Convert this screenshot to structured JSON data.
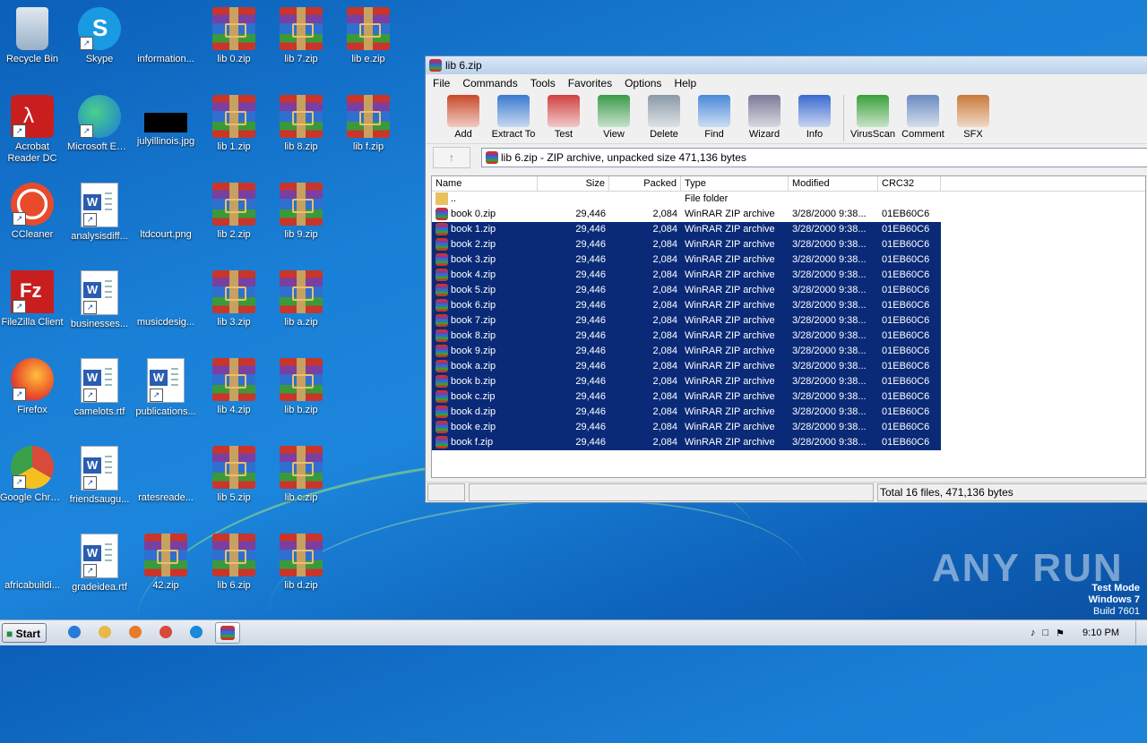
{
  "desktop": {
    "icons": [
      {
        "label": "Recycle Bin",
        "type": "recyclebin"
      },
      {
        "label": "Skype",
        "type": "skype"
      },
      {
        "label": "information...",
        "type": "blank"
      },
      {
        "label": "lib 0.zip",
        "type": "rar"
      },
      {
        "label": "lib 7.zip",
        "type": "rar"
      },
      {
        "label": "lib e.zip",
        "type": "rar"
      },
      {
        "label": "Acrobat Reader DC",
        "type": "acrobat"
      },
      {
        "label": "Microsoft Edge",
        "type": "edge"
      },
      {
        "label": "julyillinois.jpg",
        "type": "jpg"
      },
      {
        "label": "lib 1.zip",
        "type": "rar"
      },
      {
        "label": "lib 8.zip",
        "type": "rar"
      },
      {
        "label": "lib f.zip",
        "type": "rar"
      },
      {
        "label": "CCleaner",
        "type": "ccleaner"
      },
      {
        "label": "analysisdiff...",
        "type": "doc"
      },
      {
        "label": "ltdcourt.png",
        "type": "blank"
      },
      {
        "label": "lib 2.zip",
        "type": "rar"
      },
      {
        "label": "lib 9.zip",
        "type": "rar"
      },
      {
        "label": "FileZilla Client",
        "type": "filezilla"
      },
      {
        "label": "businesses...",
        "type": "doc"
      },
      {
        "label": "musicdesig...",
        "type": "blank"
      },
      {
        "label": "lib 3.zip",
        "type": "rar"
      },
      {
        "label": "lib a.zip",
        "type": "rar"
      },
      {
        "label": "Firefox",
        "type": "firefox"
      },
      {
        "label": "camelots.rtf",
        "type": "doc"
      },
      {
        "label": "publications...",
        "type": "doc"
      },
      {
        "label": "lib 4.zip",
        "type": "rar"
      },
      {
        "label": "lib b.zip",
        "type": "rar"
      },
      {
        "label": "Google Chrome",
        "type": "chrome"
      },
      {
        "label": "friendsaugu...",
        "type": "doc"
      },
      {
        "label": "ratesreade...",
        "type": "blank"
      },
      {
        "label": "lib 5.zip",
        "type": "rar"
      },
      {
        "label": "lib c.zip",
        "type": "rar"
      },
      {
        "label": "africabuildi...",
        "type": "blank"
      },
      {
        "label": "gradeidea.rtf",
        "type": "doc"
      },
      {
        "label": "42.zip",
        "type": "rar"
      },
      {
        "label": "lib 6.zip",
        "type": "rar"
      },
      {
        "label": "lib d.zip",
        "type": "rar"
      }
    ]
  },
  "window": {
    "title": "lib 6.zip",
    "menu": [
      "File",
      "Commands",
      "Tools",
      "Favorites",
      "Options",
      "Help"
    ],
    "toolbar": [
      {
        "label": "Add",
        "icon": "add-icon",
        "color": "#c84a2a"
      },
      {
        "label": "Extract To",
        "icon": "extract-icon",
        "color": "#3a7ad0"
      },
      {
        "label": "Test",
        "icon": "test-icon",
        "color": "#d04040"
      },
      {
        "label": "View",
        "icon": "view-icon",
        "color": "#3a9a4a"
      },
      {
        "label": "Delete",
        "icon": "delete-icon",
        "color": "#8a9aa8"
      },
      {
        "label": "Find",
        "icon": "find-icon",
        "color": "#4a8ad8"
      },
      {
        "label": "Wizard",
        "icon": "wizard-icon",
        "color": "#7a7a9a"
      },
      {
        "label": "Info",
        "icon": "info-icon",
        "color": "#3a6ad0"
      },
      {
        "label": "VirusScan",
        "icon": "virusscan-icon",
        "color": "#3aa03a"
      },
      {
        "label": "Comment",
        "icon": "comment-icon",
        "color": "#6a8ac0"
      },
      {
        "label": "SFX",
        "icon": "sfx-icon",
        "color": "#c87a3a"
      }
    ],
    "address": "lib 6.zip - ZIP archive, unpacked size 471,136 bytes",
    "columns": [
      "Name",
      "Size",
      "Packed",
      "Type",
      "Modified",
      "CRC32"
    ],
    "rows": [
      {
        "name": "..",
        "size": "",
        "packed": "",
        "type": "File folder",
        "modified": "",
        "crc": "",
        "selected": false,
        "folder": true
      },
      {
        "name": "book 0.zip",
        "size": "29,446",
        "packed": "2,084",
        "type": "WinRAR ZIP archive",
        "modified": "3/28/2000 9:38...",
        "crc": "01EB60C6",
        "selected": false,
        "folder": false
      },
      {
        "name": "book 1.zip",
        "size": "29,446",
        "packed": "2,084",
        "type": "WinRAR ZIP archive",
        "modified": "3/28/2000 9:38...",
        "crc": "01EB60C6",
        "selected": true,
        "folder": false
      },
      {
        "name": "book 2.zip",
        "size": "29,446",
        "packed": "2,084",
        "type": "WinRAR ZIP archive",
        "modified": "3/28/2000 9:38...",
        "crc": "01EB60C6",
        "selected": true,
        "folder": false
      },
      {
        "name": "book 3.zip",
        "size": "29,446",
        "packed": "2,084",
        "type": "WinRAR ZIP archive",
        "modified": "3/28/2000 9:38...",
        "crc": "01EB60C6",
        "selected": true,
        "folder": false
      },
      {
        "name": "book 4.zip",
        "size": "29,446",
        "packed": "2,084",
        "type": "WinRAR ZIP archive",
        "modified": "3/28/2000 9:38...",
        "crc": "01EB60C6",
        "selected": true,
        "folder": false
      },
      {
        "name": "book 5.zip",
        "size": "29,446",
        "packed": "2,084",
        "type": "WinRAR ZIP archive",
        "modified": "3/28/2000 9:38...",
        "crc": "01EB60C6",
        "selected": true,
        "folder": false
      },
      {
        "name": "book 6.zip",
        "size": "29,446",
        "packed": "2,084",
        "type": "WinRAR ZIP archive",
        "modified": "3/28/2000 9:38...",
        "crc": "01EB60C6",
        "selected": true,
        "folder": false
      },
      {
        "name": "book 7.zip",
        "size": "29,446",
        "packed": "2,084",
        "type": "WinRAR ZIP archive",
        "modified": "3/28/2000 9:38...",
        "crc": "01EB60C6",
        "selected": true,
        "folder": false
      },
      {
        "name": "book 8.zip",
        "size": "29,446",
        "packed": "2,084",
        "type": "WinRAR ZIP archive",
        "modified": "3/28/2000 9:38...",
        "crc": "01EB60C6",
        "selected": true,
        "folder": false
      },
      {
        "name": "book 9.zip",
        "size": "29,446",
        "packed": "2,084",
        "type": "WinRAR ZIP archive",
        "modified": "3/28/2000 9:38...",
        "crc": "01EB60C6",
        "selected": true,
        "folder": false
      },
      {
        "name": "book a.zip",
        "size": "29,446",
        "packed": "2,084",
        "type": "WinRAR ZIP archive",
        "modified": "3/28/2000 9:38...",
        "crc": "01EB60C6",
        "selected": true,
        "folder": false
      },
      {
        "name": "book b.zip",
        "size": "29,446",
        "packed": "2,084",
        "type": "WinRAR ZIP archive",
        "modified": "3/28/2000 9:38...",
        "crc": "01EB60C6",
        "selected": true,
        "folder": false
      },
      {
        "name": "book c.zip",
        "size": "29,446",
        "packed": "2,084",
        "type": "WinRAR ZIP archive",
        "modified": "3/28/2000 9:38...",
        "crc": "01EB60C6",
        "selected": true,
        "folder": false
      },
      {
        "name": "book d.zip",
        "size": "29,446",
        "packed": "2,084",
        "type": "WinRAR ZIP archive",
        "modified": "3/28/2000 9:38...",
        "crc": "01EB60C6",
        "selected": true,
        "folder": false
      },
      {
        "name": "book e.zip",
        "size": "29,446",
        "packed": "2,084",
        "type": "WinRAR ZIP archive",
        "modified": "3/28/2000 9:38...",
        "crc": "01EB60C6",
        "selected": true,
        "folder": false
      },
      {
        "name": "book f.zip",
        "size": "29,446",
        "packed": "2,084",
        "type": "WinRAR ZIP archive",
        "modified": "3/28/2000 9:38...",
        "crc": "01EB60C6",
        "selected": true,
        "folder": false
      }
    ],
    "status": "Total 16 files, 471,136 bytes"
  },
  "taskbar": {
    "start_label": "Start",
    "clock": "9:10 PM",
    "apps": [
      {
        "icon": "ie-icon",
        "color": "#2a7ad8"
      },
      {
        "icon": "explorer-icon",
        "color": "#e8b84a"
      },
      {
        "icon": "media-player-icon",
        "color": "#e87a2a"
      },
      {
        "icon": "chrome-icon",
        "color": "#d84a3a"
      },
      {
        "icon": "edge-icon",
        "color": "#1a8ad8"
      },
      {
        "icon": "winrar-icon",
        "color": "#8a3aa0"
      }
    ]
  },
  "watermark": {
    "line1": "Test Mode",
    "line2": "Windows 7",
    "line3": "Build 7601",
    "brand": "ANY RUN"
  },
  "colors": {
    "selection": "#0a2a78",
    "desktop_bg": "#1a7fd6"
  }
}
